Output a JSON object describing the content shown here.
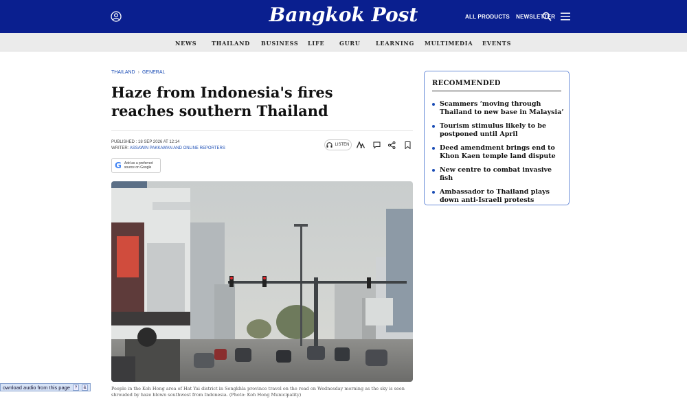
{
  "header": {
    "logo": "Bangkok Post",
    "links": [
      "ALL PRODUCTS",
      "NEWSLETTER"
    ],
    "bg_color": "#0a1f8f"
  },
  "nav": {
    "items": [
      "NEWS",
      "THAILAND",
      "BUSINESS",
      "LIFE",
      "GURU",
      "LEARNING",
      "MULTIMEDIA",
      "EVENTS"
    ]
  },
  "article": {
    "breadcrumb": [
      "THAILAND",
      "GENERAL"
    ],
    "headline": "Haze from Indonesia's fires reaches southern Thailand",
    "published": "PUBLISHED : 18 SEP 2026 AT 12:14",
    "writer_label": "WRITER:",
    "writer": "ASSAWIN PAKKAWAN AND ONLINE REPORTERS",
    "listen_label": "LISTEN",
    "google_badge": "Add as a preferred source on Google",
    "caption": "People in the Koh Hong area of Hat Yai district in Songkhla province travel on the road on Wednesday morning as the sky is seen shrouded by haze blown southwest from Indonesia. (Photo: Koh Hong Municipality)"
  },
  "sidebar": {
    "title": "RECOMMENDED",
    "items": [
      "Scammers ‘moving through Thailand to new base in Malaysia’",
      "Tourism stimulus likely to be postponed until April",
      "Deed amendment brings end to Khon Kaen temple land dispute",
      "New centre to combat invasive fish",
      "Ambassador to Thailand plays down anti-Israeli protests"
    ]
  },
  "audio_widget": {
    "label": "ownload audio from this page",
    "btn1": "?",
    "btn2": "&"
  }
}
